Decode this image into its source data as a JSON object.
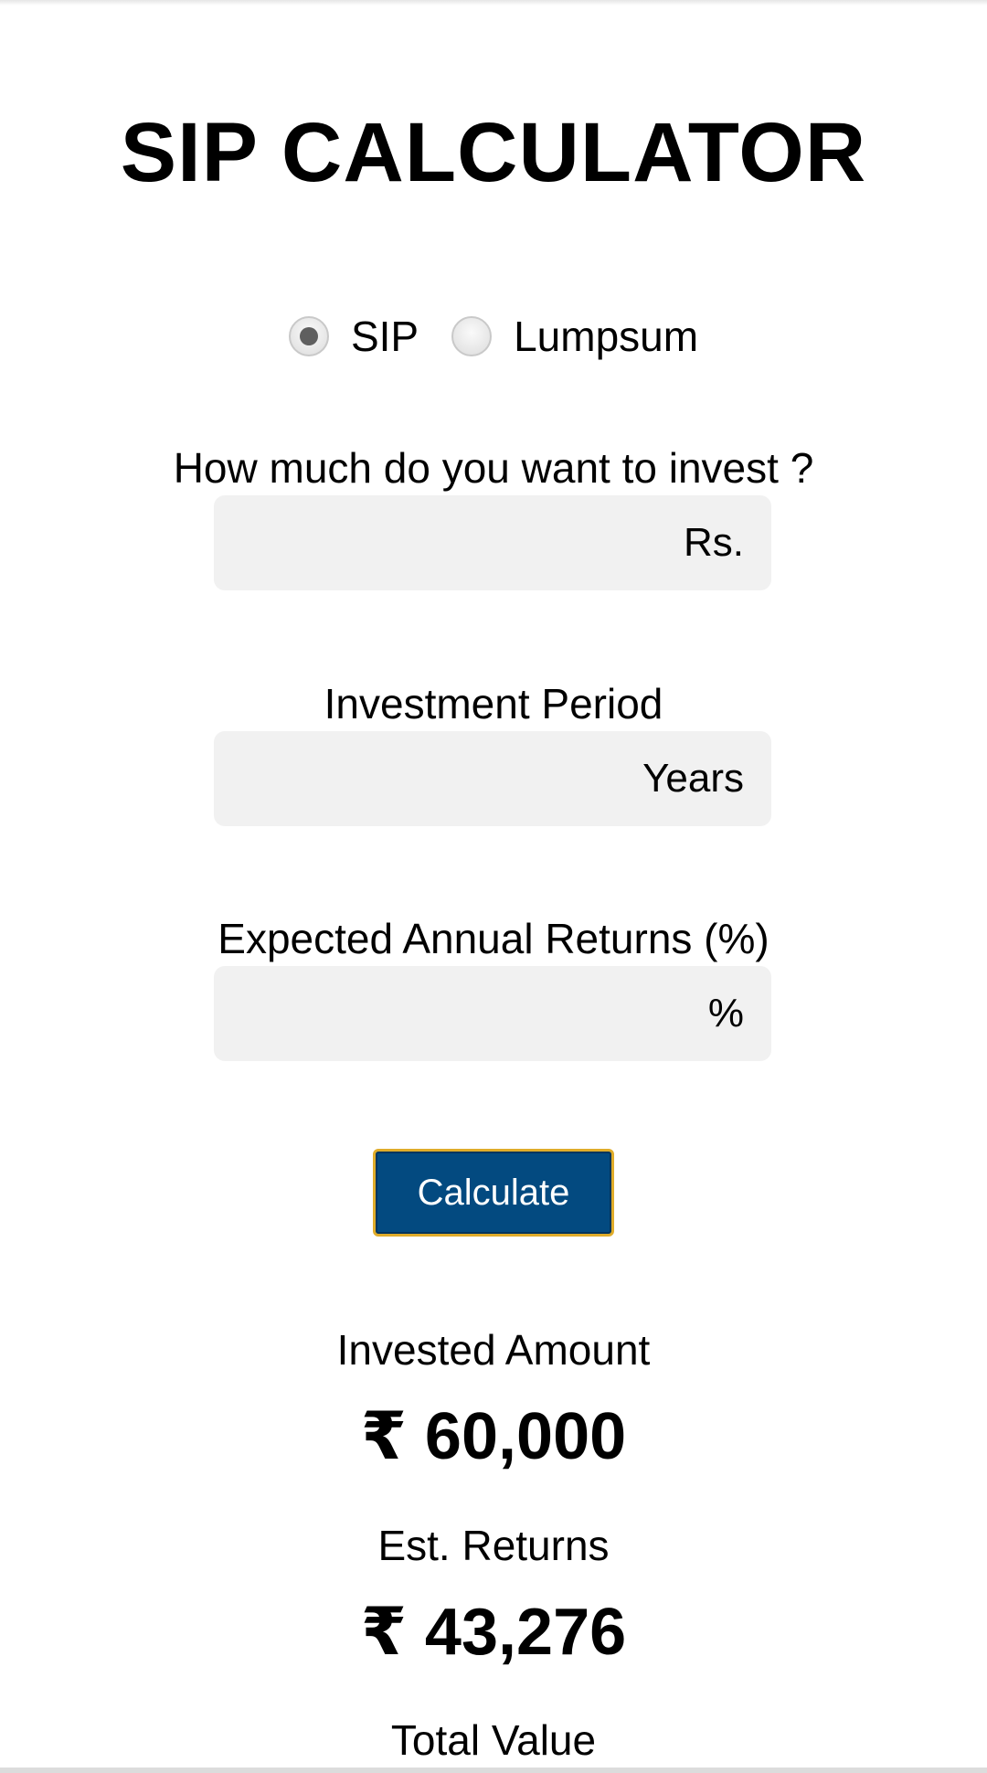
{
  "title": "SIP CALCULATOR",
  "mode": {
    "options": [
      {
        "label": "SIP",
        "selected": true
      },
      {
        "label": "Lumpsum",
        "selected": false
      }
    ]
  },
  "fields": {
    "amount": {
      "label": "How much do you want to invest ?",
      "value": "",
      "suffix": "Rs."
    },
    "period": {
      "label": "Investment Period",
      "value": "",
      "suffix": "Years"
    },
    "returns": {
      "label": "Expected Annual Returns (%)",
      "value": "",
      "suffix": "%"
    }
  },
  "calculate_label": "Calculate",
  "results": {
    "invested": {
      "label": "Invested Amount",
      "value": "₹ 60,000"
    },
    "est_returns": {
      "label": "Est. Returns",
      "value": "₹ 43,276"
    },
    "total": {
      "label": "Total Value"
    }
  },
  "colors": {
    "button_bg": "#034a80",
    "button_border": "#e0ac2a",
    "input_bg": "#f1f1f1"
  }
}
